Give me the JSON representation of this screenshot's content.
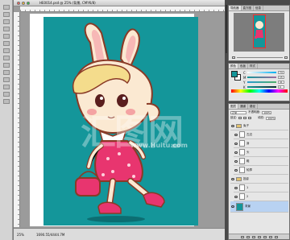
{
  "document": {
    "title": "HE0014.psd @ 25% (背景, CMYK/8)",
    "zoom": "25%",
    "info": "1690.55/4444.7M"
  },
  "panels": {
    "navigator": {
      "tabs": [
        "导航器",
        "直方图",
        "信息"
      ]
    },
    "color": {
      "tabs": [
        "颜色",
        "色板",
        "样式"
      ],
      "rows": [
        {
          "label": "C",
          "value": "74"
        },
        {
          "label": "M",
          "value": "15"
        },
        {
          "label": "Y",
          "value": "41"
        },
        {
          "label": "K",
          "value": "0"
        }
      ],
      "foreground": "#14969a",
      "background": "#ffffff"
    },
    "layers": {
      "tabs": [
        "图层",
        "通道",
        "路径"
      ],
      "blend_mode": "正常",
      "opacity_label": "不透明度:",
      "opacity_value": "100%",
      "lock_label": "锁定:",
      "fill_label": "填充:",
      "fill_value": "100%",
      "items": [
        {
          "name": "兔子",
          "type": "group"
        },
        {
          "name": "左边",
          "type": "layer"
        },
        {
          "name": "身",
          "type": "layer"
        },
        {
          "name": "头",
          "type": "layer"
        },
        {
          "name": "鞋",
          "type": "layer"
        },
        {
          "name": "轮廓",
          "type": "layer"
        },
        {
          "name": "投影",
          "type": "group"
        },
        {
          "name": "1",
          "type": "layer"
        },
        {
          "name": "2",
          "type": "layer"
        },
        {
          "name": "背景",
          "type": "layer",
          "selected": true
        }
      ]
    }
  },
  "watermark": {
    "text": "汇图网",
    "url": "www.Huitu.com"
  },
  "colors": {
    "canvas": "#14969a",
    "accent_pink": "#e8356f"
  }
}
